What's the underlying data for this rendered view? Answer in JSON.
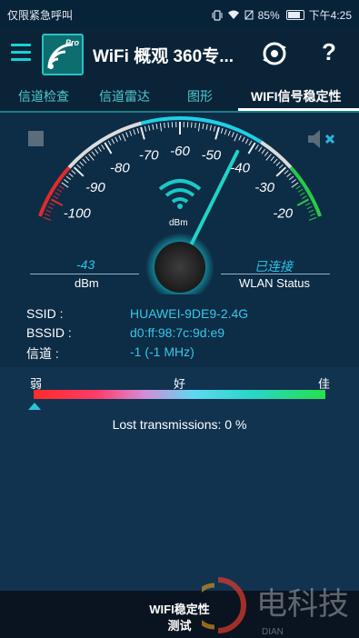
{
  "status_bar": {
    "carrier": "仅限紧急呼叫",
    "battery": "85%",
    "time": "下午4:25"
  },
  "app_bar": {
    "title": "WiFi 概观 360专...",
    "logo_badge": "Pro"
  },
  "tabs": [
    {
      "label": "信道检查",
      "active": false
    },
    {
      "label": "信道雷达",
      "active": false
    },
    {
      "label": "图形",
      "active": false
    },
    {
      "label": "WIFI信号稳定性",
      "active": true
    }
  ],
  "gauge": {
    "scale_labels": [
      "-100",
      "-90",
      "-80",
      "-70",
      "-60",
      "-50",
      "-40",
      "-30",
      "-20"
    ],
    "unit_label": "dBm",
    "needle_value": -43,
    "signal_value": "-43",
    "signal_unit": "dBm",
    "wlan_status": "已连接",
    "wlan_label": "WLAN Status",
    "colors": {
      "low": "#e02b2b",
      "mid": "#dcdcdc",
      "high": "#27c94a",
      "needle": "#21d2c6",
      "accent": "#1fd0e6"
    }
  },
  "network": {
    "ssid_label": "SSID :",
    "ssid": "HUAWEI-9DE9-2.4G",
    "bssid_label": "BSSID :",
    "bssid": "d0:ff:98:7c:9d:e9",
    "channel_label": "信道 :",
    "channel": "-1 (-1 MHz)"
  },
  "quality": {
    "weak": "弱",
    "good": "好",
    "excellent": "佳",
    "marker_fraction": 0,
    "lost_transmissions": "Lost transmissions: 0 %"
  },
  "bottom": {
    "line1": "WIFI稳定性",
    "line2": "测试"
  },
  "watermark": {
    "text": "电科技",
    "sub": "DIAN"
  }
}
